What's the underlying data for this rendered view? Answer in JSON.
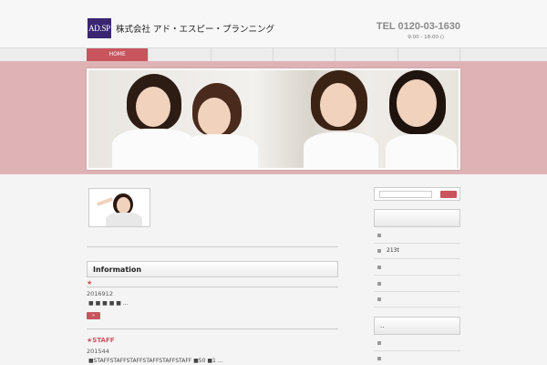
{
  "header": {
    "logo_text": "AD.SP",
    "company": "株式会社 アド・エスピー・プランニング",
    "tel": "TEL 0120-03-1630",
    "hours": "9:00 - 18:00 ()"
  },
  "nav": {
    "items": [
      {
        "label": "HOME"
      },
      {
        "label": ""
      },
      {
        "label": ""
      },
      {
        "label": ""
      },
      {
        "label": ""
      },
      {
        "label": ""
      }
    ]
  },
  "info": {
    "title": "Information",
    "posts": [
      {
        "title": "★",
        "date": "2016912",
        "excerpt": "■ ■ ■ ■ ■ ..."
      },
      {
        "title": "★STAFF",
        "date": "201544",
        "excerpt": "■STAFFSTAFFSTAFFSTAFFSTAFFSTAFF ■50 ■1 ..."
      }
    ],
    "more_label": "»"
  },
  "sidebar": {
    "sections": [
      {
        "title": "",
        "items": [
          "",
          "213t",
          "",
          "",
          ""
        ]
      },
      {
        "title": "..",
        "items": [
          "",
          ""
        ]
      }
    ]
  },
  "colors": {
    "accent": "#c8555e",
    "band": "#dfb3b6",
    "logo": "#3a2670"
  }
}
